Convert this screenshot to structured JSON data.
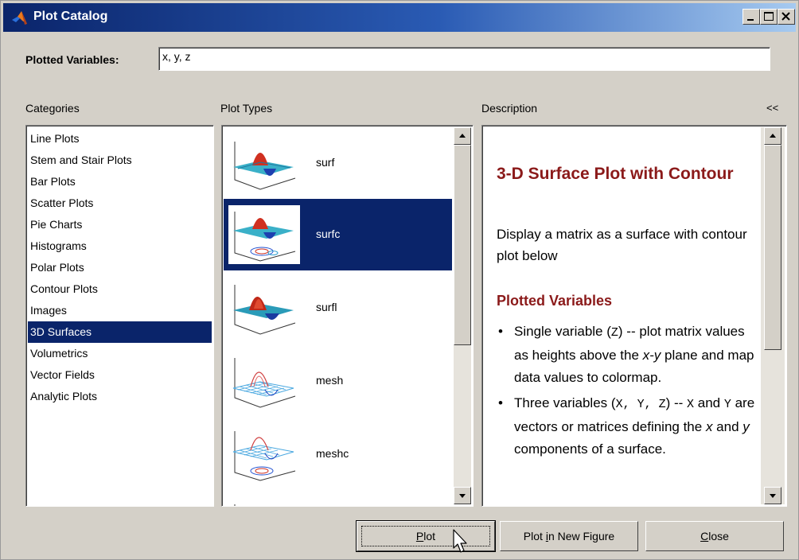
{
  "window": {
    "title": "Plot Catalog",
    "controls": [
      "minimize-icon",
      "maximize-icon",
      "close-icon"
    ]
  },
  "variables": {
    "label": "Plotted Variables:",
    "value": "x, y, z"
  },
  "categories": {
    "heading": "Categories",
    "selected": "3D Surfaces",
    "items": [
      "Line Plots",
      "Stem and Stair Plots",
      "Bar Plots",
      "Scatter Plots",
      "Pie Charts",
      "Histograms",
      "Polar Plots",
      "Contour Plots",
      "Images",
      "3D Surfaces",
      "Volumetrics",
      "Vector Fields",
      "Analytic Plots"
    ]
  },
  "plot_types": {
    "heading": "Plot Types",
    "selected": "surfc",
    "items": [
      "surf",
      "surfc",
      "surfl",
      "mesh",
      "meshc"
    ]
  },
  "description": {
    "heading": "Description",
    "collapse_label": "<<",
    "title": "3-D Surface Plot with Contour",
    "summary": "Display a matrix as a surface with contour plot below",
    "subheading": "Plotted Variables",
    "bullet1": {
      "a": "Single variable (",
      "code1": "Z",
      "b": ") -- plot matrix values as heights above the ",
      "em1": "x-y",
      "c": " plane and map data values to colormap."
    },
    "bullet2": {
      "a": "Three variables (",
      "code1": "X, Y, Z",
      "b": ") -- ",
      "code2": "X",
      "c": " and ",
      "code3": "Y",
      "d": " are vectors or matrices defining the ",
      "em1": "x",
      "e": " and ",
      "em2": "y",
      "f": " components of a surface."
    }
  },
  "buttons": {
    "plot": {
      "pre": "",
      "key": "P",
      "post": "lot"
    },
    "plot_new": {
      "pre": "Plot ",
      "key": "i",
      "post": "n New Figure"
    },
    "close": {
      "pre": "",
      "key": "C",
      "post": "lose"
    }
  },
  "colors": {
    "title_gradient_start": "#0a246a",
    "selection": "#0a246a",
    "description_title": "#8b1a1a",
    "face": "#d4d0c8"
  }
}
